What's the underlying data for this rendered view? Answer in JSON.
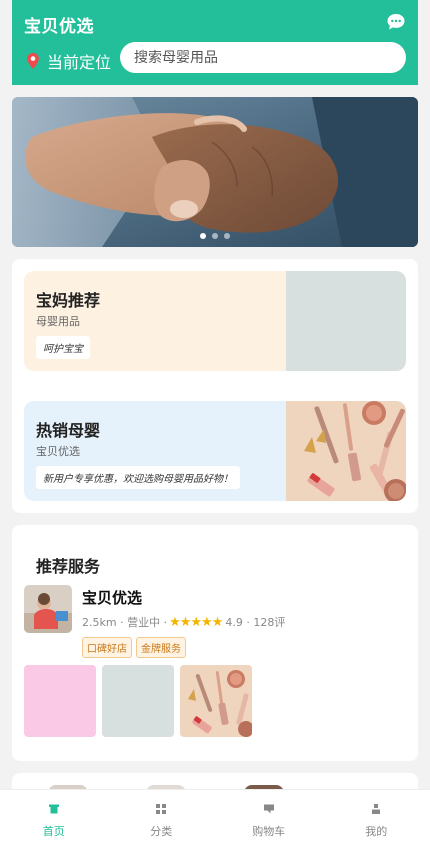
{
  "header": {
    "title": "宝贝优选",
    "location_label": "当前定位",
    "search_placeholder": "搜索母婴用品"
  },
  "banner": {
    "slide_count": 3,
    "active_slide": 1
  },
  "promos": [
    {
      "title": "宝妈推荐",
      "subtitle": "母婴用品",
      "tag": "呵护宝宝"
    },
    {
      "title": "热销母婴",
      "subtitle": "宝贝优选",
      "tag": "新用户专享优惠，欢迎选购母婴用品好物！"
    }
  ],
  "services": {
    "title": "推荐服务",
    "store": {
      "name": "宝贝优选",
      "distance": "2.5km",
      "status": "营业中",
      "stars": "★★★★★",
      "rating": "4.9",
      "reviews": "128评",
      "badges": [
        "口碑好店",
        "金牌服务"
      ]
    }
  },
  "tabbar": {
    "items": [
      {
        "label": "首页",
        "icon": "home-icon"
      },
      {
        "label": "分类",
        "icon": "category-grid-icon"
      },
      {
        "label": "购物车",
        "icon": "cart-icon"
      },
      {
        "label": "我的",
        "icon": "user-icon"
      }
    ],
    "active_index": 0
  },
  "colors": {
    "brand": "#22bf9a",
    "star": "#f5b400",
    "badge_text": "#c97a1a"
  }
}
